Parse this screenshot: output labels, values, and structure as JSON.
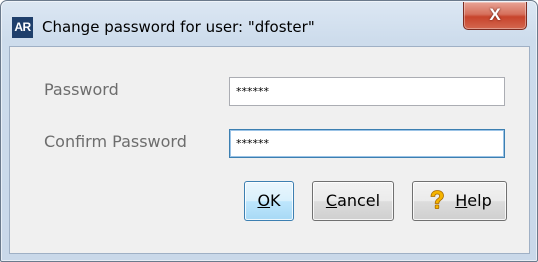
{
  "window": {
    "app_icon_text": "AR",
    "title": "Change password for user: \"dfoster\"",
    "close_label": "X"
  },
  "form": {
    "password_label": "Password",
    "password_value": "******",
    "confirm_label": "Confirm Password",
    "confirm_value": "******"
  },
  "buttons": {
    "ok": {
      "mnemonic": "O",
      "rest": "K"
    },
    "cancel": {
      "mnemonic": "C",
      "rest": "ancel"
    },
    "help": {
      "mnemonic": "H",
      "rest": "elp",
      "icon": "question-icon"
    }
  },
  "colors": {
    "close_button": "#c7442c",
    "app_icon": "#1f3f6b",
    "focus_border": "#3c7fb1",
    "help_icon": "#f5b400"
  }
}
